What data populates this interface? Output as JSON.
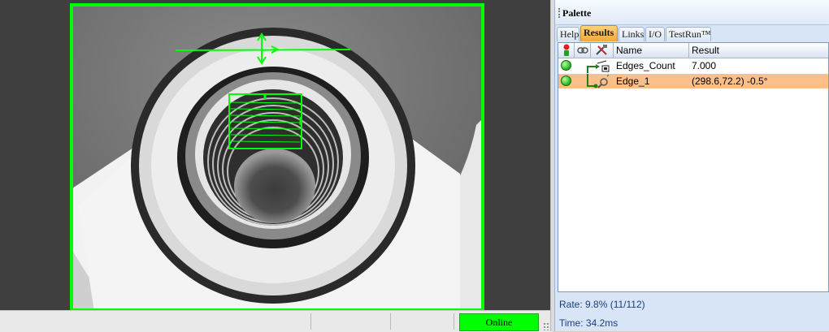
{
  "palette": {
    "title": "Palette",
    "tabs": [
      {
        "label": "Help",
        "active": false
      },
      {
        "label": "Results",
        "active": true
      },
      {
        "label": "Links",
        "active": false
      },
      {
        "label": "I/O",
        "active": false
      },
      {
        "label": "TestRun™",
        "active": false
      }
    ],
    "columns": {
      "name": "Name",
      "result": "Result"
    },
    "rows": [
      {
        "name": "Edges_Count",
        "result": "7.000",
        "status": "pass",
        "icon": "count-tool-icon",
        "selected": false
      },
      {
        "name": "Edge_1",
        "result": "(298.6,72.2) -0.5°",
        "status": "pass",
        "icon": "edge-tool-icon",
        "selected": true
      }
    ],
    "rate": "Rate: 9.8% (11/112)",
    "time": "Time: 34.2ms"
  },
  "statusbar": {
    "online_label": "Online"
  },
  "colors": {
    "overlay_green": "#00ff00",
    "selected_row": "#fbc08a",
    "panel_bg": "#d7e5f6"
  }
}
